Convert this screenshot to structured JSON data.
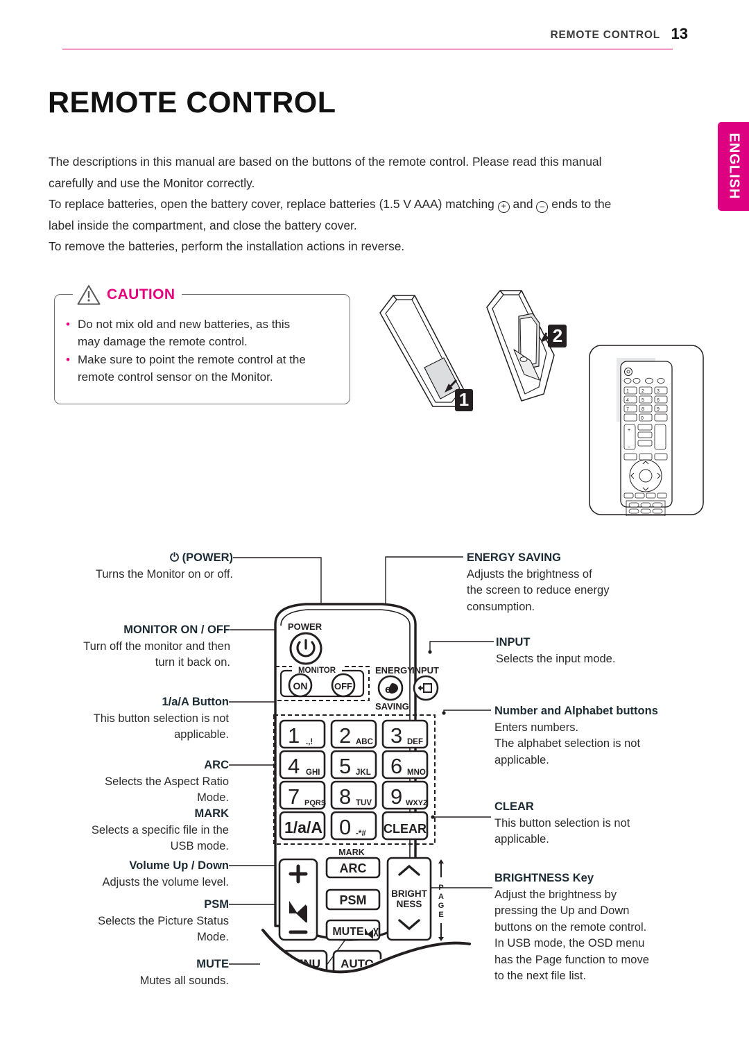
{
  "header": {
    "title": "REMOTE CONTROL",
    "page_number": "13"
  },
  "language_tab": {
    "label": "ENGLISH",
    "color": "#dd0081"
  },
  "main": {
    "title": "REMOTE CONTROL",
    "intro": [
      "The descriptions in this manual are based on the buttons of the remote control. Please read this manual carefully and use the Monitor correctly.",
      "To replace batteries, open the battery cover, replace batteries (1.5 V AAA) matching ⊕ and ⊖ ends to the label inside the compartment, and close the battery cover.",
      "To remove the batteries, perform the installation actions in reverse."
    ],
    "intro_line1": "The descriptions in this manual are based on the buttons of the remote control. Please read this manual",
    "intro_line2": "carefully and use the Monitor correctly.",
    "intro_line3a": "To replace batteries, open the battery cover, replace batteries (1.5 V AAA) matching",
    "plus_symbol": "+",
    "intro_line3b": "and",
    "minus_symbol": "–",
    "intro_line3c": "ends to the",
    "intro_line4": "label inside the compartment, and close the battery cover.",
    "intro_line5": "To remove the batteries, perform the installation actions in reverse."
  },
  "caution": {
    "title": "CAUTION",
    "icon": "warning-triangle-icon",
    "accent_color": "#e6007e",
    "items": [
      "Do not mix old and new batteries, as this may damage the remote control.",
      "Make sure to point the remote control at the remote control sensor on the Monitor."
    ],
    "item1_line1": "Do not mix old and new batteries, as this",
    "item1_line2": "may damage the remote control.",
    "item2_line1": "Make sure to point the remote control at the",
    "item2_line2": "remote control sensor on the Monitor."
  },
  "battery_illustration": {
    "step1_label": "1",
    "step2_label": "2"
  },
  "callouts_left": [
    {
      "title": "⏻ (POWER)",
      "lines": [
        "Turns the Monitor on or off."
      ]
    },
    {
      "title": "MONITOR ON / OFF",
      "lines": [
        "Turn off the monitor and then",
        "turn it back on."
      ]
    },
    {
      "title": "1/a/A Button",
      "lines": [
        "This button selection is not",
        "applicable."
      ]
    },
    {
      "title": "ARC",
      "lines": [
        "Selects the Aspect Ratio",
        "Mode."
      ]
    },
    {
      "title": "MARK",
      "lines": [
        "Selects a specific file in the",
        "USB mode."
      ]
    },
    {
      "title": "Volume Up / Down",
      "lines": [
        "Adjusts the volume level."
      ]
    },
    {
      "title": "PSM",
      "lines": [
        "Selects the Picture Status",
        "Mode."
      ]
    },
    {
      "title": "MUTE",
      "lines": [
        "Mutes all sounds."
      ]
    }
  ],
  "callouts_right": [
    {
      "title": "ENERGY SAVING",
      "lines": [
        "Adjusts the brightness of",
        "the screen to reduce energy",
        "consumption."
      ]
    },
    {
      "title": "INPUT",
      "lines": [
        "Selects the input mode."
      ]
    },
    {
      "title": "Number and Alphabet buttons",
      "lines": [
        "Enters numbers.",
        "The alphabet selection is not",
        "applicable."
      ]
    },
    {
      "title": "CLEAR",
      "lines": [
        "This button selection is not",
        "applicable."
      ]
    },
    {
      "title": "BRIGHTNESS Key",
      "lines": [
        "Adjust the brightness by",
        "pressing the Up and Down",
        "buttons on the remote control.",
        "In USB mode, the OSD menu",
        "has the Page function to move",
        "to the next file list."
      ]
    }
  ],
  "remote_diagram": {
    "power_label": "POWER",
    "monitor_label": "MONITOR",
    "monitor_on": "ON",
    "monitor_off": "OFF",
    "energy_label": "ENERGY",
    "saving_label": "SAVING",
    "input_label": "INPUT",
    "mark_label": "MARK",
    "page_label": "PAGE",
    "keypad": [
      {
        "digit": "1",
        "letters": ".,!"
      },
      {
        "digit": "2",
        "letters": "ABC"
      },
      {
        "digit": "3",
        "letters": "DEF"
      },
      {
        "digit": "4",
        "letters": "GHI"
      },
      {
        "digit": "5",
        "letters": "JKL"
      },
      {
        "digit": "6",
        "letters": "MNO"
      },
      {
        "digit": "7",
        "letters": "PQRS"
      },
      {
        "digit": "8",
        "letters": "TUV"
      },
      {
        "digit": "9",
        "letters": "WXYZ"
      },
      {
        "digit": "1/a/A",
        "letters": ""
      },
      {
        "digit": "0",
        "letters": "-*#"
      },
      {
        "digit": "CLEAR",
        "letters": ""
      }
    ],
    "arc_button": "ARC",
    "psm_button": "PSM",
    "mute_button": "MUTE",
    "brightness_line1": "BRIGHT",
    "brightness_line2": "NESS",
    "menu_button": "MENU",
    "auto_button": "AUTO",
    "volume_plus": "+",
    "volume_minus": "–"
  }
}
